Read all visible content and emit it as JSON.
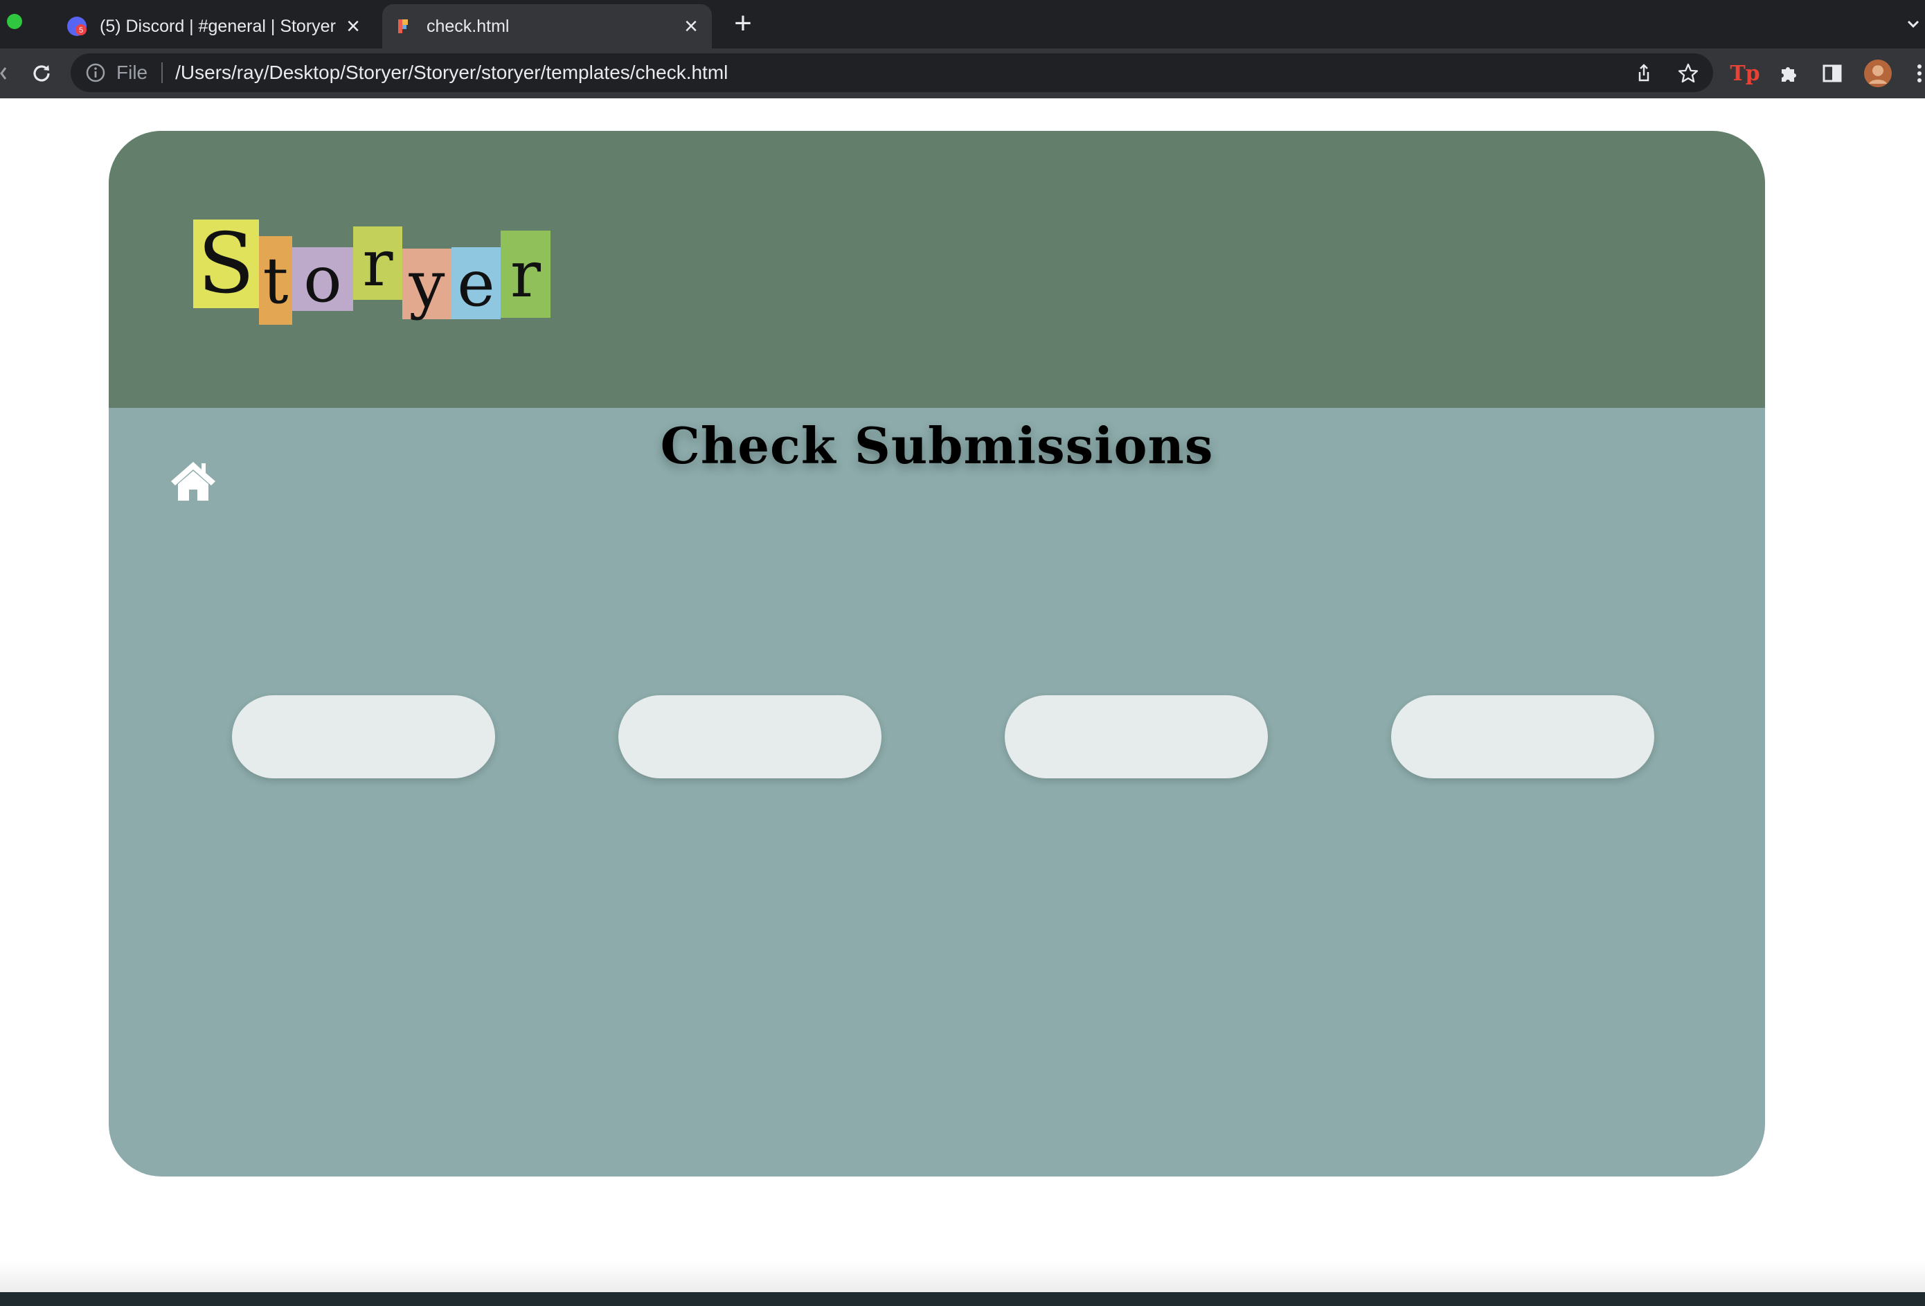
{
  "browser": {
    "tabs": [
      {
        "title": "(5) Discord | #general | Storyer",
        "active": false,
        "favicon": "discord-icon",
        "badge": "5"
      },
      {
        "title": "check.html",
        "active": true,
        "favicon": "file-icon"
      }
    ],
    "new_tab_label": "+",
    "close_label": "×",
    "address": {
      "scheme_label": "File",
      "url": "/Users/ray/Desktop/Storyer/Storyer/storyer/templates/check.html"
    },
    "extension_label": "Tp"
  },
  "page": {
    "logo_letters": [
      "S",
      "t",
      "o",
      "r",
      "y",
      "e",
      "r"
    ],
    "title": "Check Submissions",
    "submission_buttons": [
      "",
      "",
      "",
      ""
    ]
  },
  "colors": {
    "header": "#637f6c",
    "body": "#8cabaa",
    "pill": "#e6ebeb",
    "logo_tiles": [
      "#dfe25a",
      "#e3a653",
      "#bdaacb",
      "#c3d15b",
      "#e2a98e",
      "#8ec7df",
      "#8fc05a"
    ]
  }
}
